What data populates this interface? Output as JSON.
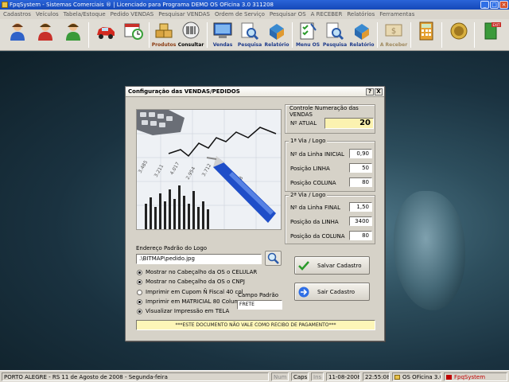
{
  "window": {
    "title": "FpqSystem - Sistemas Comerciais ®  |  Licenciado para  Programa DEMO OS OFicina 3.0 311208"
  },
  "menu": [
    "Cadastros",
    "Veículos",
    "Tabela/Estoque",
    "Pedido VENDAS",
    "Pesquisar VENDAS",
    "Ordem de Serviço",
    "Pesquisar OS",
    "A RECEBER",
    "Relatórios",
    "Ferramentas"
  ],
  "toolbar": {
    "produtos": "Produtos",
    "consultar": "Consultar",
    "vendas": "Vendas",
    "pesquisa1": "Pesquisa",
    "relatorio1": "Relatório",
    "menu_os": "Menu OS",
    "pesquisa2": "Pesquisa",
    "relatorio2": "Relatório",
    "a_receber": "A Receber"
  },
  "dialog": {
    "title": "Configuração das VENDAS/PEDIDOS",
    "help": "?",
    "close": "X",
    "numeracao": {
      "title": "Controle Numeração das VENDAS",
      "label": "Nº ATUAL",
      "value": "20"
    },
    "via1": {
      "title": "1ª Via / Logo",
      "linha_inicial_label": "Nº da Linha INICIAL",
      "linha_inicial": "0,90",
      "pos_linha_label": "Posição LINHA",
      "pos_linha": "50",
      "pos_coluna_label": "Posição COLUNA",
      "pos_coluna": "80"
    },
    "via2": {
      "title": "2ª Via / Logo",
      "linha_final_label": "Nº da Linha FINAL",
      "linha_final": "1,50",
      "pos_linha_label": "Posição da LINHA",
      "pos_linha": "3400",
      "pos_coluna_label": "Posição da COLUNA",
      "pos_coluna": "80"
    },
    "logo": {
      "label": "Endereço Padrão do Logo",
      "value": ".\\BITMAP\\pedido.jpg"
    },
    "options": [
      {
        "label": "Mostrar no Cabeçalho da OS o CELULAR",
        "checked": true
      },
      {
        "label": "Mostrar no Cabeçalho da OS o CNPJ",
        "checked": true
      },
      {
        "label": "Imprimir em Cupom Ñ Fiscal 40 col",
        "checked": false
      },
      {
        "label": "Imprimir em MATRICIAL 80 Colunas",
        "checked": true
      },
      {
        "label": "Visualizar Impressão em TELA",
        "checked": true
      }
    ],
    "campo_padrao": {
      "label": "Campo Padrão",
      "value": "FRETE"
    },
    "salvar": "Salvar Cadastro",
    "sair": "Sair Cadastro",
    "warning": "***ESTE DOCUMENTO NÃO VALE COMO RECIBO DE PAGAMENTO***"
  },
  "status": {
    "location": "PORTO ALEGRE - RS 11 de Agosto de 2008 - Segunda-feira",
    "num": "Num",
    "caps": "Caps",
    "ins": "Ins",
    "date": "11-08-2008",
    "time": "22:55:08",
    "app": "OS OFicina 3.0",
    "brand": "FpqSystem"
  },
  "colors": {
    "titlebar": "#1548b8",
    "numero_field": "#fbf2b0",
    "warning_field": "#fdf6b8",
    "brand_red": "#c00000"
  }
}
